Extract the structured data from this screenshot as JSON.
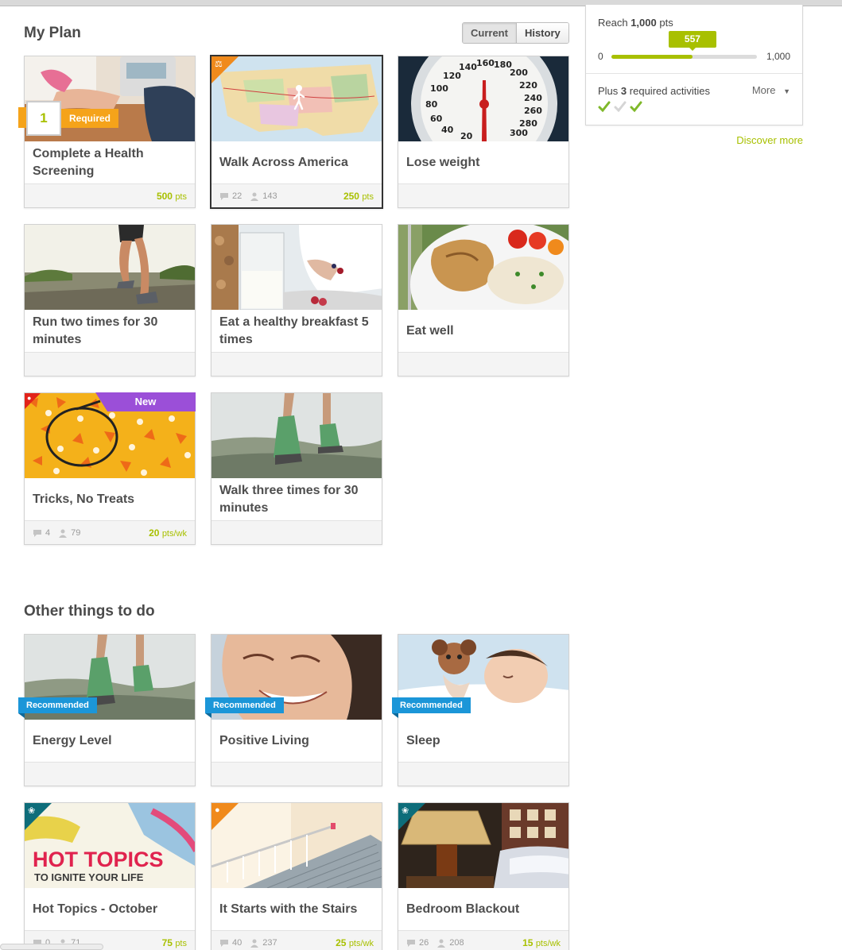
{
  "header": {
    "title": "My Plan",
    "tabs": [
      {
        "label": "Current",
        "active": true
      },
      {
        "label": "History",
        "active": false
      }
    ]
  },
  "sidebar": {
    "reach_prefix": "Reach",
    "reach_value": "1,000",
    "reach_suffix": "pts",
    "progress": {
      "min": "0",
      "max": "1,000",
      "current": "557",
      "fraction": 0.557
    },
    "plus_prefix": "Plus",
    "plus_count": "3",
    "plus_suffix": "required activities",
    "more_label": "More",
    "checks": [
      "done",
      "pending",
      "done"
    ],
    "discover_label": "Discover more"
  },
  "my_plan_cards": [
    {
      "title": "Complete a Health Screening",
      "points": "500",
      "unit": "pts",
      "badge_number": "1",
      "badge_label": "Required",
      "image": "blood-pressure-photo"
    },
    {
      "title": "Walk Across America",
      "comments": "22",
      "participants": "143",
      "points": "250",
      "unit": "pts",
      "image": "usa-map-photo",
      "selected": true
    },
    {
      "title": "Lose weight",
      "image": "scale-photo"
    },
    {
      "title": "Run two times for 30 minutes",
      "image": "runner-photo"
    },
    {
      "title": "Eat a healthy breakfast 5 times",
      "image": "breakfast-photo"
    },
    {
      "title": "Eat well",
      "image": "healthy-plate-photo"
    },
    {
      "title": "Tricks, No Treats",
      "comments": "4",
      "participants": "79",
      "points": "20",
      "unit": "pts/wk",
      "ribbon": "New",
      "image": "candy-corn-photo"
    },
    {
      "title": "Walk three times for 30 minutes",
      "image": "walking-shoes-photo"
    }
  ],
  "other_section": {
    "title": "Other things to do"
  },
  "other_cards": [
    {
      "title": "Energy Level",
      "ribbon": "Recommended",
      "image": "walking-shoes-photo"
    },
    {
      "title": "Positive Living",
      "ribbon": "Recommended",
      "image": "smiling-woman-photo"
    },
    {
      "title": "Sleep",
      "ribbon": "Recommended",
      "image": "sleeping-baby-photo"
    },
    {
      "title": "Hot Topics - October",
      "comments": "0",
      "participants": "71",
      "points": "75",
      "unit": "pts",
      "image_text_1": "HOT TOPICS",
      "image_text_2": "TO IGNITE YOUR LIFE"
    },
    {
      "title": "It Starts with the Stairs",
      "comments": "40",
      "participants": "237",
      "points": "25",
      "unit": "pts/wk",
      "image": "stairs-photo"
    },
    {
      "title": "Bedroom Blackout",
      "comments": "26",
      "participants": "208",
      "points": "15",
      "unit": "pts/wk",
      "image": "bedroom-lamp-photo"
    }
  ],
  "colors": {
    "accent": "#a8c000",
    "recommended": "#1b96d8",
    "required": "#f5a31a",
    "new": "#9b4fd8"
  }
}
